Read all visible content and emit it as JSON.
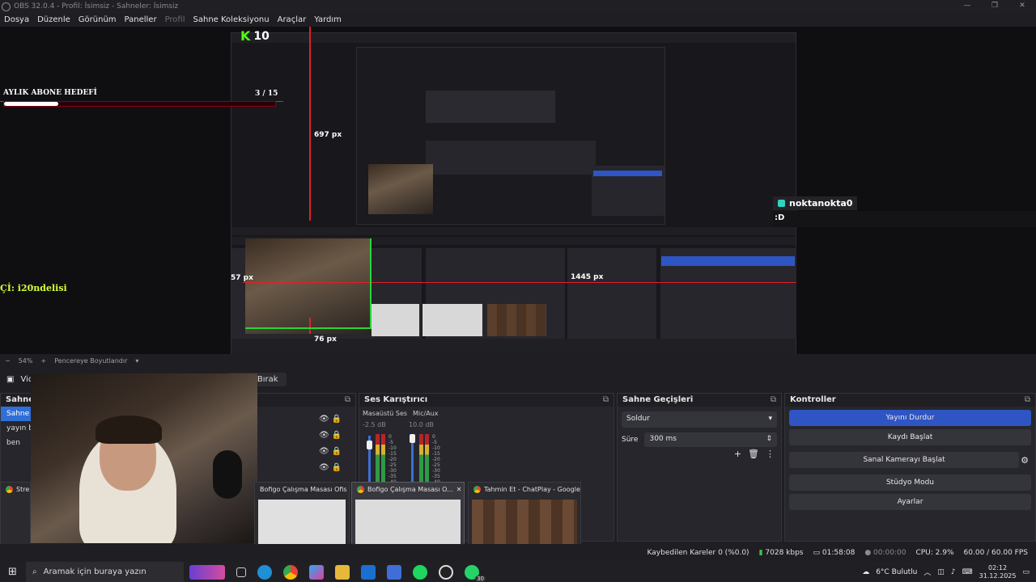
{
  "window": {
    "title": "OBS 32.0.4 - Profil: İsimsiz - Sahneler: İsimsiz"
  },
  "menu": [
    "Dosya",
    "Düzenle",
    "Görünüm",
    "Paneller",
    "Profil",
    "Sahne Koleksiyonu",
    "Araçlar",
    "Yardım"
  ],
  "overlay": {
    "goal_title": "AYLIK ABONE HEDEFİ",
    "goal_count": "3 / 15",
    "goal_progress": 0.2,
    "donor": "Çİ: i20ndelisi",
    "kick_count": "10",
    "chat_user": "noktanokta0",
    "chat_msg": ":D",
    "measure_h": "697 px",
    "measure_w": "1445 px",
    "measure_l": "57 px",
    "measure_b": "76 px"
  },
  "scale": {
    "zoom": "54%",
    "mode": "Pencereye Boyutlandır"
  },
  "sourcebar": {
    "source": "Vid",
    "release": "ndışı Bırak"
  },
  "scenes": {
    "title": "Sahnel",
    "items": [
      "Sahne",
      "yayın ba",
      "ben"
    ]
  },
  "mixer": {
    "title": "Ses Karıştırıcı",
    "channels": [
      {
        "name": "Masaüstü Ses",
        "db": "-2.5 dB"
      },
      {
        "name": "Mic/Aux",
        "db": "10.0 dB"
      }
    ],
    "scale": [
      "0",
      "-5",
      "-10",
      "-15",
      "-20",
      "-25",
      "-30",
      "-35",
      "-40"
    ]
  },
  "transitions": {
    "title": "Sahne Geçişleri",
    "type": "Soldur",
    "duration_label": "Süre",
    "duration": "300 ms"
  },
  "controls": {
    "title": "Kontroller",
    "buttons": [
      "Yayını Durdur",
      "Kaydı Başlat",
      "Sanal Kamerayı Başlat",
      "Stüdyo Modu",
      "Ayarlar"
    ]
  },
  "status": {
    "dropped": "Kaybedilen Kareler 0 (%0.0)",
    "bitrate": "7028 kbps",
    "live": "01:58:08",
    "rec": "00:00:00",
    "cpu": "CPU: 2.9%",
    "fps": "60.00 / 60.00 FPS"
  },
  "hover_cards": [
    {
      "title": "Stre"
    },
    {
      "title": "Bofigo Çalışma Masası Ofis Ma..."
    },
    {
      "title": "Bofigo Çalışma Masası O..."
    },
    {
      "title": "Tahmin Et - ChatPlay - Google ..."
    }
  ],
  "taskbar": {
    "search_placeholder": "Aramak için buraya yazın",
    "weather": "6°C  Bulutlu",
    "time": "02:12",
    "date": "31.12.2025",
    "whatsapp_badge": "30"
  }
}
